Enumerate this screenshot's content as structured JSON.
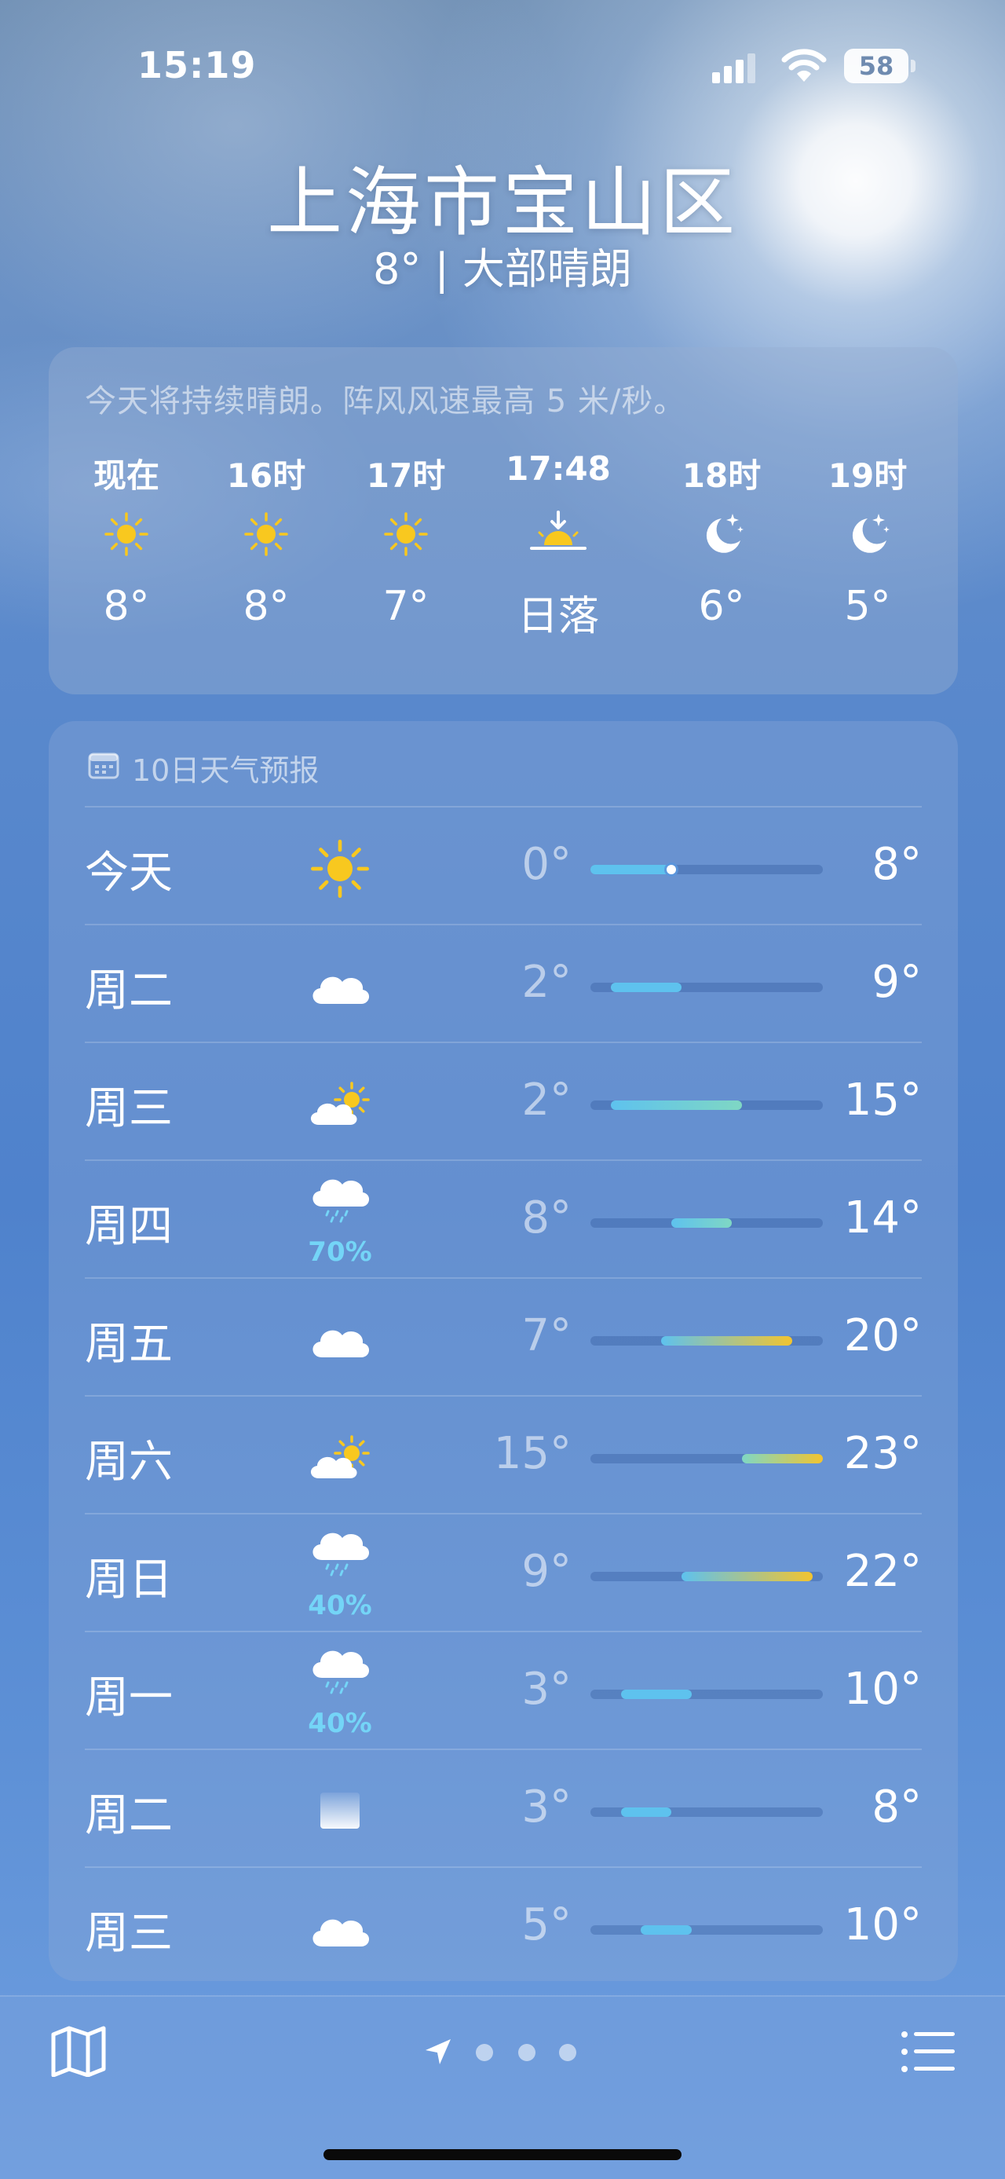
{
  "status_bar": {
    "time": "15:19",
    "battery": "58"
  },
  "header": {
    "city": "上海市宝山区",
    "summary": "8° | 大部晴朗"
  },
  "hourly": {
    "note": "今天将持续晴朗。阵风风速最高 5 米/秒。",
    "items": [
      {
        "label": "现在",
        "icon": "sun-icon",
        "temp": "8°"
      },
      {
        "label": "16时",
        "icon": "sun-icon",
        "temp": "8°"
      },
      {
        "label": "17时",
        "icon": "sun-icon",
        "temp": "7°"
      },
      {
        "label": "17:48",
        "icon": "sunset-icon",
        "temp": "日落"
      },
      {
        "label": "18时",
        "icon": "moon-stars-icon",
        "temp": "6°"
      },
      {
        "label": "19时",
        "icon": "moon-stars-icon",
        "temp": "5°"
      }
    ]
  },
  "daily": {
    "title": "10日天气预报",
    "range": [
      0,
      23
    ],
    "current_temp": 8,
    "days": [
      {
        "name": "今天",
        "icon": "sun-icon",
        "pop": "",
        "low": "0°",
        "high": "8°",
        "low_v": 0,
        "high_v": 8
      },
      {
        "name": "周二",
        "icon": "cloud-icon",
        "pop": "",
        "low": "2°",
        "high": "9°",
        "low_v": 2,
        "high_v": 9
      },
      {
        "name": "周三",
        "icon": "partly-sunny-icon",
        "pop": "",
        "low": "2°",
        "high": "15°",
        "low_v": 2,
        "high_v": 15
      },
      {
        "name": "周四",
        "icon": "rain-cloud-icon",
        "pop": "70%",
        "low": "8°",
        "high": "14°",
        "low_v": 8,
        "high_v": 14
      },
      {
        "name": "周五",
        "icon": "cloud-icon",
        "pop": "",
        "low": "7°",
        "high": "20°",
        "low_v": 7,
        "high_v": 20
      },
      {
        "name": "周六",
        "icon": "partly-sunny-icon",
        "pop": "",
        "low": "15°",
        "high": "23°",
        "low_v": 15,
        "high_v": 23
      },
      {
        "name": "周日",
        "icon": "rain-cloud-icon",
        "pop": "40%",
        "low": "9°",
        "high": "22°",
        "low_v": 9,
        "high_v": 22
      },
      {
        "name": "周一",
        "icon": "rain-cloud-icon",
        "pop": "40%",
        "low": "3°",
        "high": "10°",
        "low_v": 3,
        "high_v": 10
      },
      {
        "name": "周二",
        "icon": "fog-icon",
        "pop": "",
        "low": "3°",
        "high": "8°",
        "low_v": 3,
        "high_v": 8
      },
      {
        "name": "周三",
        "icon": "cloud-icon",
        "pop": "",
        "low": "5°",
        "high": "10°",
        "low_v": 5,
        "high_v": 10
      }
    ]
  },
  "colors": {
    "sun": "#f8c81f",
    "precip": "#74d5f7",
    "cold": "#5ec2ee",
    "mild": "#7fd7c4",
    "warm": "#f2c430"
  }
}
